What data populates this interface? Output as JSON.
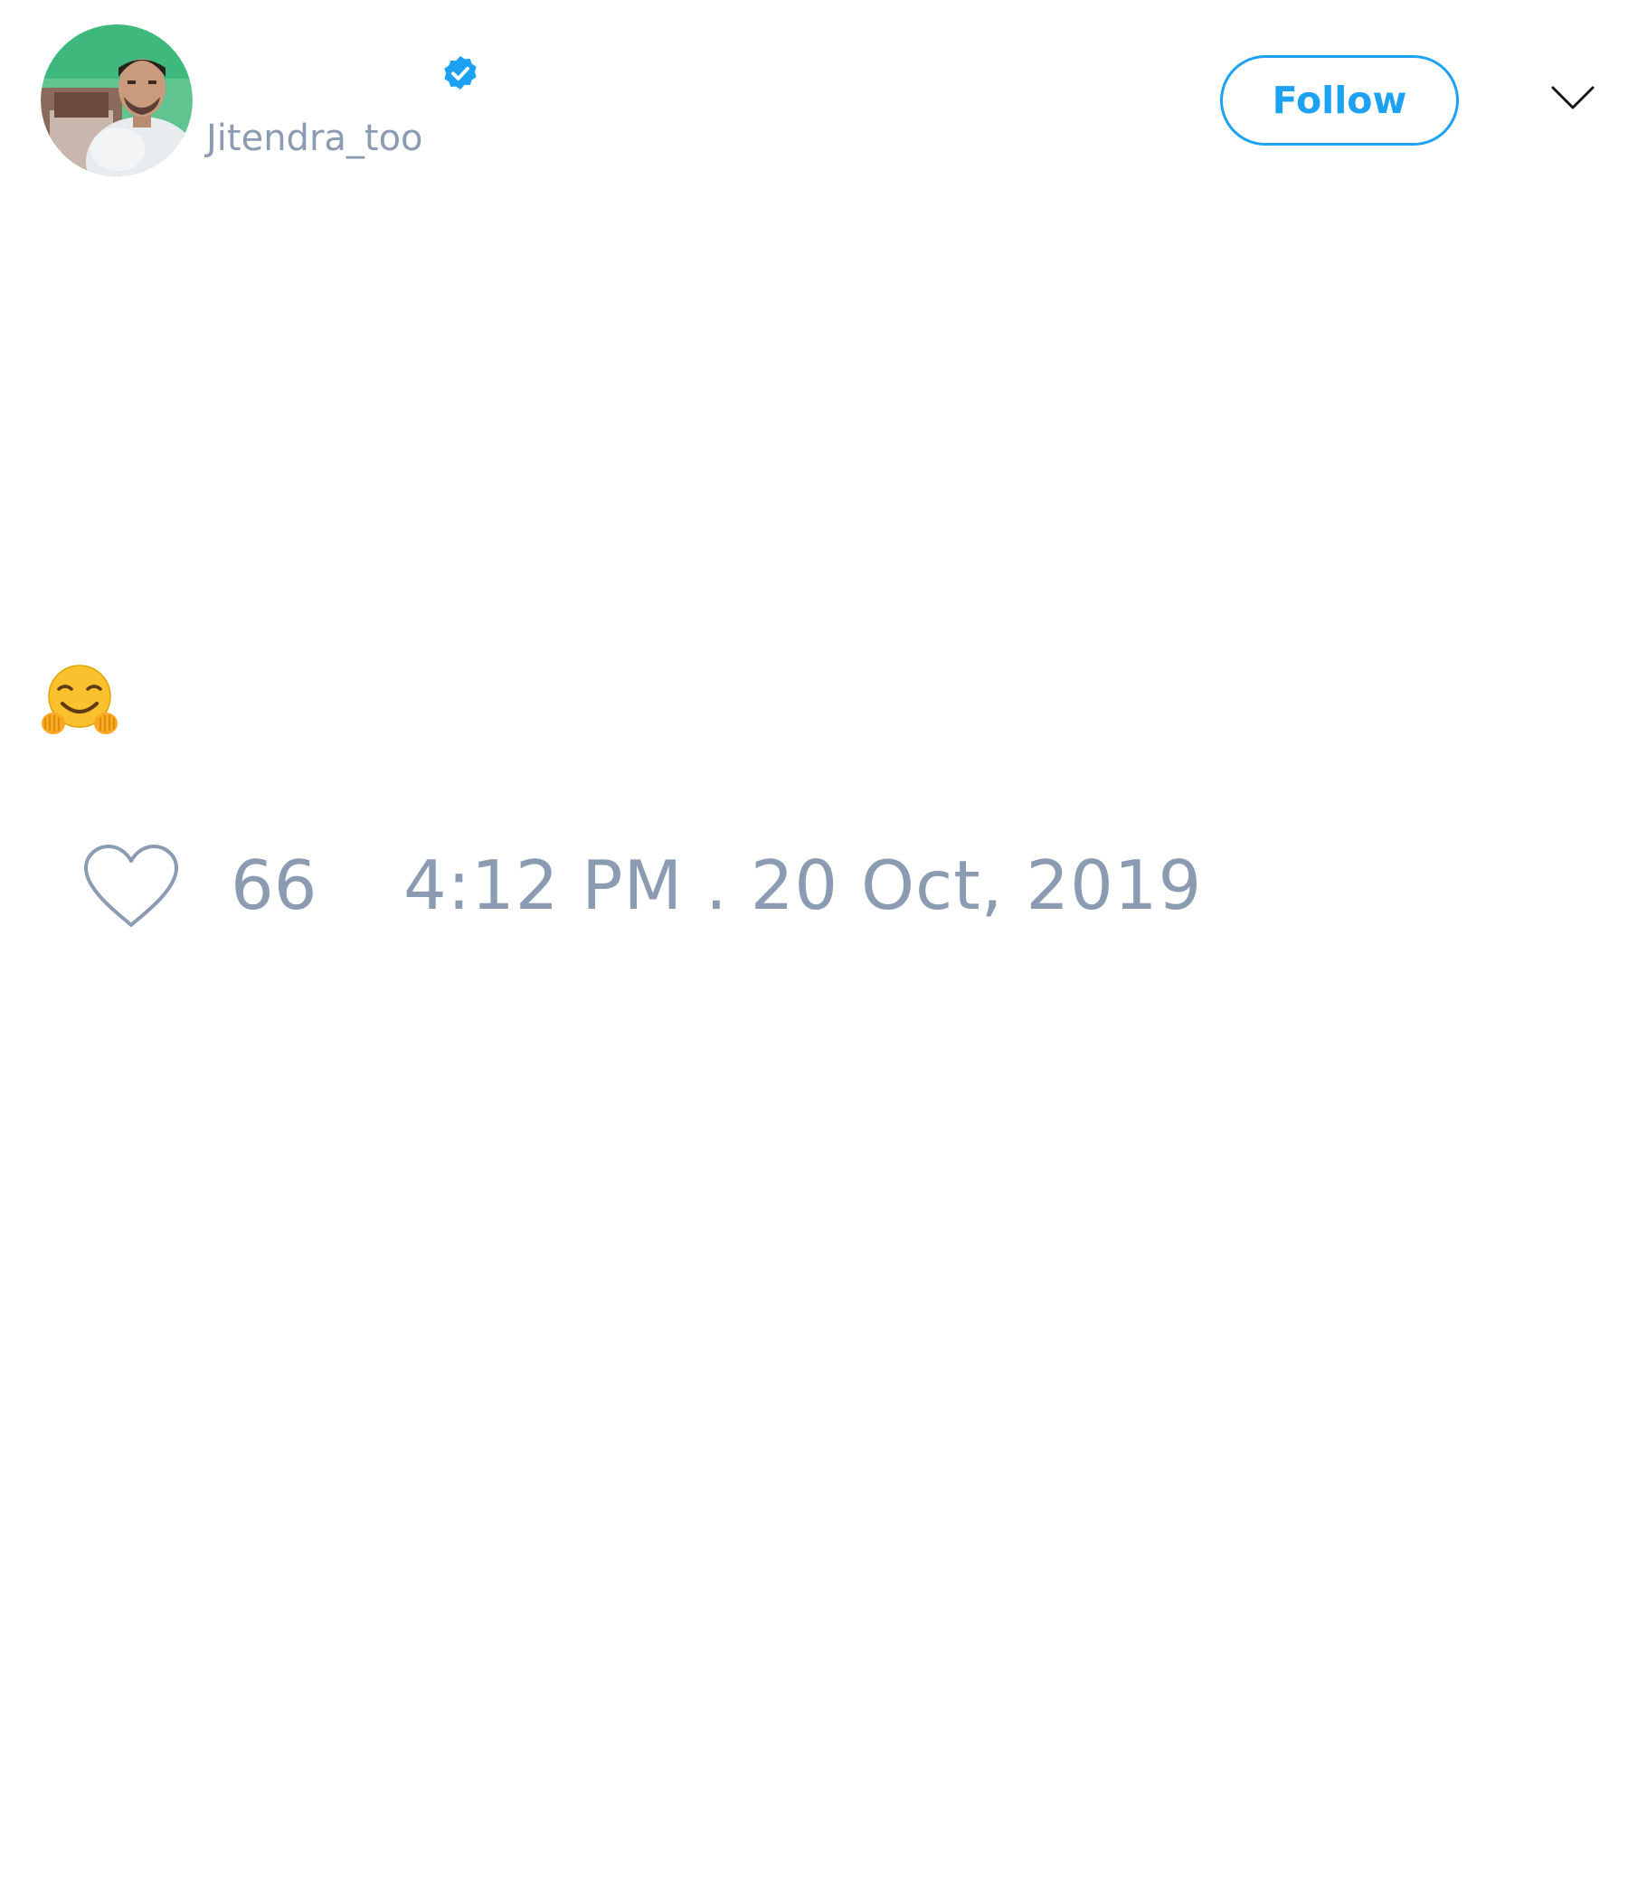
{
  "author": {
    "handle": "Jitendra_too",
    "avatar_icon": "profile-photo",
    "verified_icon": "verified-badge-icon"
  },
  "header": {
    "follow_label": "Follow",
    "more_icon": "chevron-down-icon"
  },
  "tweet": {
    "emoji_icon": "hugging-face-emoji"
  },
  "footer": {
    "like_icon": "heart-icon",
    "like_count": "66",
    "timestamp": "4:12 PM . 20 Oct, 2019"
  },
  "colors": {
    "accent": "#1da1f2",
    "muted_text": "#8b9bb1"
  }
}
